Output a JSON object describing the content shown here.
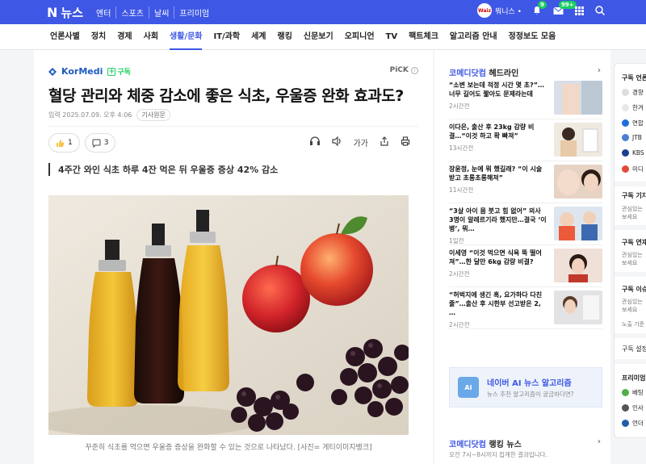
{
  "topbar": {
    "logo_n": "N",
    "logo_text": "뉴스",
    "nav": [
      "엔터",
      "스포츠",
      "날씨",
      "프리미엄"
    ],
    "avatar_label": "Waiz",
    "user_label": "뭐니스 •",
    "notification_badge": "9",
    "mail_badge": "99+"
  },
  "categories": [
    "언론사별",
    "정치",
    "경제",
    "사회",
    "생활/문화",
    "IT/과학",
    "세계",
    "랭킹",
    "신문보기",
    "오피니언",
    "TV",
    "팩트체크",
    "알고리즘 안내",
    "정정보도 모음"
  ],
  "active_category": "생활/문화",
  "article": {
    "press_name": "KorMedi",
    "subscribe_label": "구독",
    "pick_label": "PiCK",
    "title": "혈당 관리와 체중 감소에 좋은 식초, 우울증 완화 효과도?",
    "date_label": "입력",
    "date": "2025.07.09. 오후 4:06",
    "original_link": "기사원문",
    "like_count": "1",
    "comment_count": "3",
    "font_tool": "가가",
    "summary": "4주간 와인 식초 하루 4잔 먹은 뒤 우울증 증상 42% 감소",
    "caption": "꾸준히 식초를 먹으면 우울증 증상을 완화할 수 있는 것으로 나타났다. [사진= 게티이미지뱅크]"
  },
  "sidebar": {
    "headline_brand": "코메디닷컴",
    "headline_title": "헤드라인",
    "items": [
      {
        "title": "“소변 보는데 적정 시간 몇 초?”…너무 길어도 짧아도 문제라는데",
        "time": "2시간전"
      },
      {
        "title": "이다은, 출산 후 23kg 감량 비결…“이것 하고 확 빠져”",
        "time": "13시간전"
      },
      {
        "title": "장윤정, 눈에 뭐 했길래? “이 시술 받고 초롱초롱해져”",
        "time": "11시간전"
      },
      {
        "title": "“3살 아이 몸 붓고 힘 없어” 의사 3명이 알레르기라 했지만…결국 ‘이 병’, 뭐…",
        "time": "1일전"
      },
      {
        "title": "이세영 “이것 먹으면 식욕 뚝 떨어져”…한 달만 6kg 감량 비결?",
        "time": "2시간전"
      },
      {
        "title": "“허벅지에 생긴 혹, 요가하다 다친 줄”…출산 후 시한부 선고받은 2, …",
        "time": "2시간전"
      }
    ],
    "ai_title": "네이버 AI 뉴스 알고리즘",
    "ai_subtitle": "뉴스 추천 알고리즘이 궁금하다면?",
    "ai_icon_label": "AI",
    "ranking_brand": "코메디닷컴",
    "ranking_title": "랭킹 뉴스",
    "ranking_sub": "오전 7시~8시까지 집계한 결과입니다."
  },
  "farcol": {
    "subscribed_title": "구독 언론사",
    "press": [
      "경향",
      "한겨",
      "연합",
      "JTB",
      "KBS",
      "미디"
    ],
    "reporter_title": "구독 기자",
    "reporter_text": [
      "관심있는",
      "보세요"
    ],
    "series_title": "구독 연재",
    "series_text": [
      "관심있는",
      "보세요"
    ],
    "issue_title": "구독 이슈",
    "issue_text": [
      "관심있는",
      "보세요",
      "노출 기준"
    ],
    "settings": "구독 설정",
    "premium_title": "프리미엄",
    "premium": [
      "베팅",
      "인사",
      "언더"
    ]
  },
  "colors": {
    "brand_blue": "#3e57e4",
    "subscribe_green": "#19ce60"
  }
}
